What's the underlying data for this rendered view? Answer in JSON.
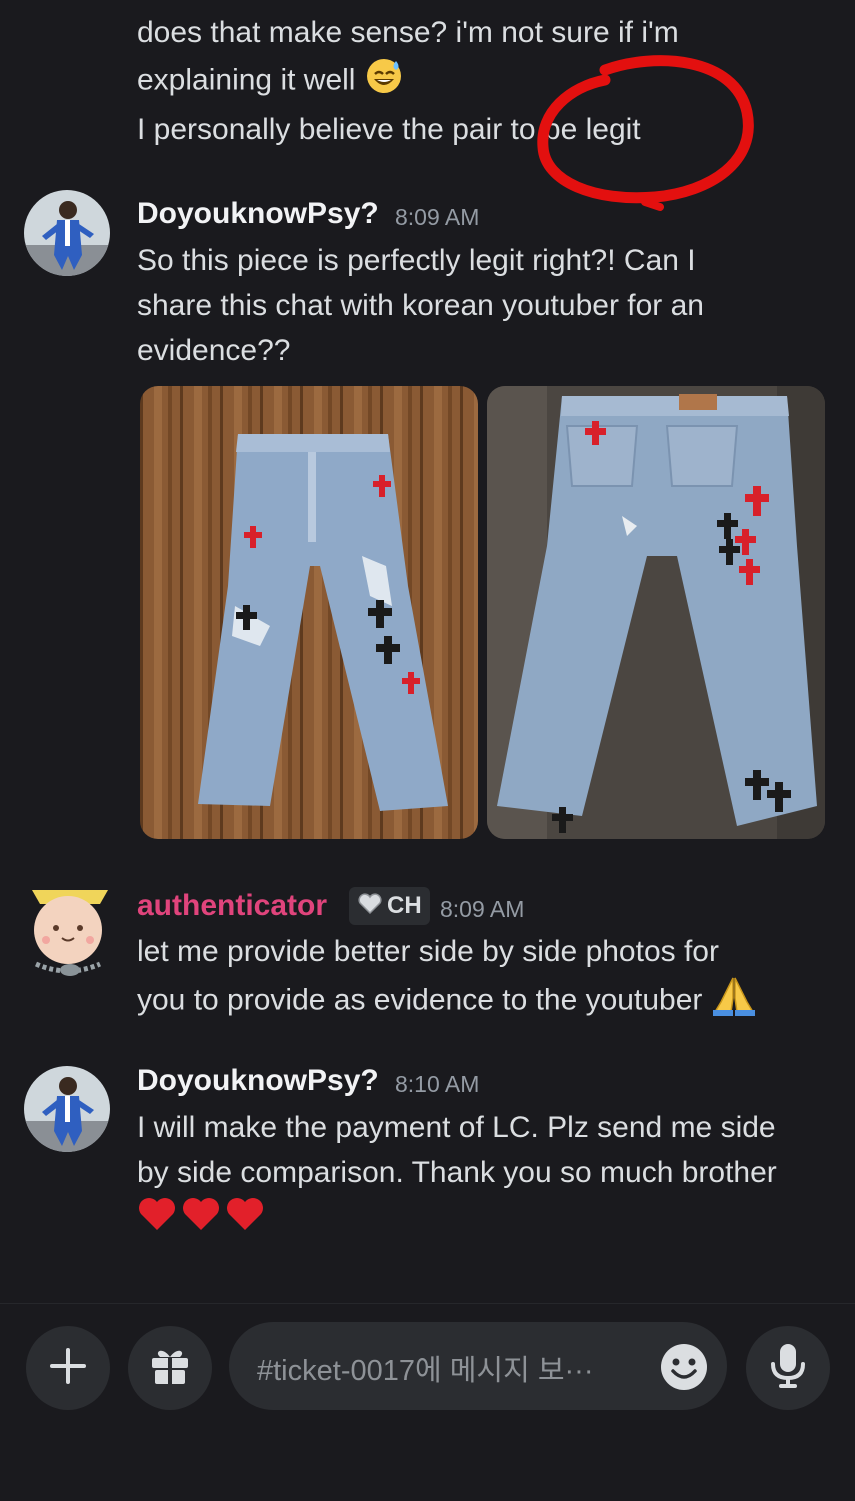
{
  "messages": {
    "top": {
      "line1": "does that make sense? i'm not sure if i'm",
      "line2": "explaining it well",
      "line3": "I personally believe the pair to be legit"
    },
    "psy1": {
      "author": "DoyouknowPsy?",
      "time": "8:09 AM",
      "line1": "So this piece is perfectly legit right?! Can I",
      "line2": "share this chat with korean youtuber for an",
      "line3": "evidence??"
    },
    "auth": {
      "author": "authenticator",
      "badge": "CH",
      "time": "8:09 AM",
      "line1": "let me provide better side by side photos for",
      "line2": "you to provide as evidence to the youtuber"
    },
    "psy2": {
      "author": "DoyouknowPsy?",
      "time": "8:10 AM",
      "line1": "I will make the payment of LC. Plz send me side",
      "line2": "by side comparison. Thank you so much brother"
    }
  },
  "composer": {
    "placeholder": "#ticket-0017에 메시지 보···"
  },
  "colors": {
    "background": "#1a1a1e",
    "authenticator_name": "#e0447c",
    "annotation": "#e3100f"
  },
  "icons": [
    "sweat-smile-emoji",
    "pray-emoji",
    "heart-emoji",
    "plus-icon",
    "gift-icon",
    "emoji-face-icon",
    "microphone-icon"
  ]
}
